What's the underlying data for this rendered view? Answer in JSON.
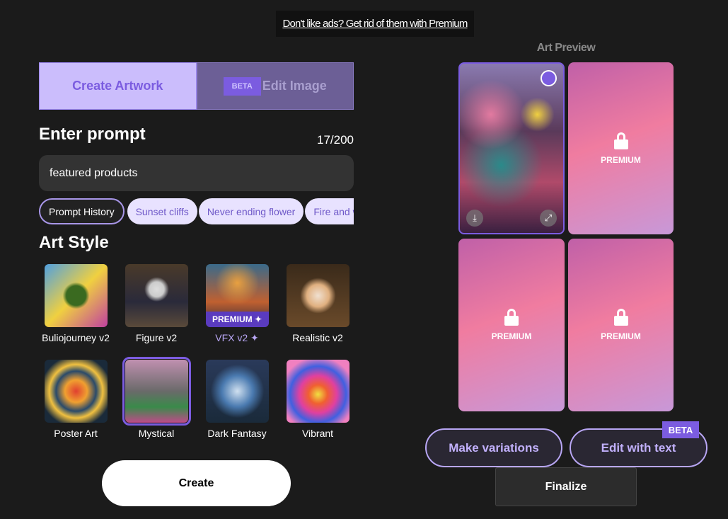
{
  "ad_banner": "Don't like ads? Get rid of them with Premium",
  "tabs": {
    "create": "Create Artwork",
    "edit": "Edit Image",
    "edit_badge": "BETA"
  },
  "prompt": {
    "title": "Enter prompt",
    "counter": "17/200",
    "value": "featured products"
  },
  "chips": [
    "Prompt History",
    "Sunset cliffs",
    "Never ending flower",
    "Fire and water"
  ],
  "art_style": {
    "title": "Art Style",
    "premium_tag": "PREMIUM ✦",
    "items": [
      {
        "label": "Buliojourney v2"
      },
      {
        "label": "Figure v2"
      },
      {
        "label": "VFX v2 ✦",
        "premium": true
      },
      {
        "label": "Realistic v2"
      },
      {
        "label": "Poster Art"
      },
      {
        "label": "Mystical",
        "selected": true
      },
      {
        "label": "Dark Fantasy"
      },
      {
        "label": "Vibrant"
      }
    ]
  },
  "create_button": "Create",
  "preview": {
    "title": "Art Preview",
    "locked_label": "PREMIUM",
    "download_icon": "⤓",
    "expand_icon": "⤢"
  },
  "actions": {
    "variations": "Make variations",
    "edit_text": "Edit with text",
    "edit_badge": "BETA",
    "finalize": "Finalize"
  },
  "colors": {
    "accent": "#7b5ce0",
    "tab_active": "#cbbdfc",
    "background": "#1b1b1b"
  }
}
